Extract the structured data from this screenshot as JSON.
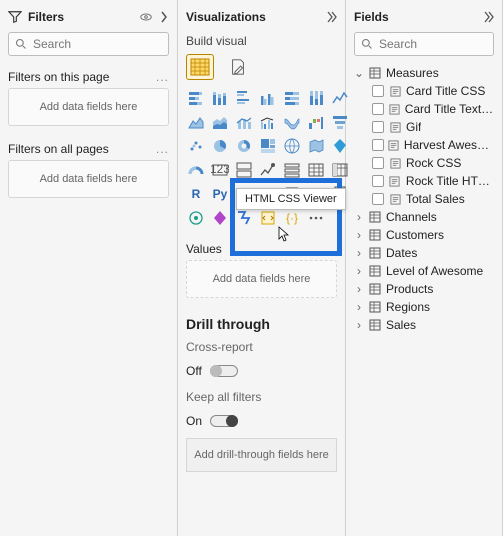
{
  "filters": {
    "title": "Filters",
    "search_placeholder": "Search",
    "section_page": "Filters on this page",
    "section_all": "Filters on all pages",
    "well_text": "Add data fields here"
  },
  "viz": {
    "title": "Visualizations",
    "build_label": "Build visual",
    "tooltip": "HTML CSS Viewer",
    "values_label": "Values",
    "values_well": "Add data fields here",
    "drill_title": "Drill through",
    "cross_label": "Cross-report",
    "cross_state": "Off",
    "keep_label": "Keep all filters",
    "keep_state": "On",
    "drill_well": "Add drill-through fields here"
  },
  "fields": {
    "title": "Fields",
    "search_placeholder": "Search",
    "measures_table": "Measures",
    "measures": [
      "Card Title CSS",
      "Card Title Text H...",
      "Gif",
      "Harvest Awesome...",
      "Rock CSS",
      "Rock Title HTML",
      "Total Sales"
    ],
    "tables": [
      "Channels",
      "Customers",
      "Dates",
      "Level of Awesome",
      "Products",
      "Regions",
      "Sales"
    ]
  }
}
